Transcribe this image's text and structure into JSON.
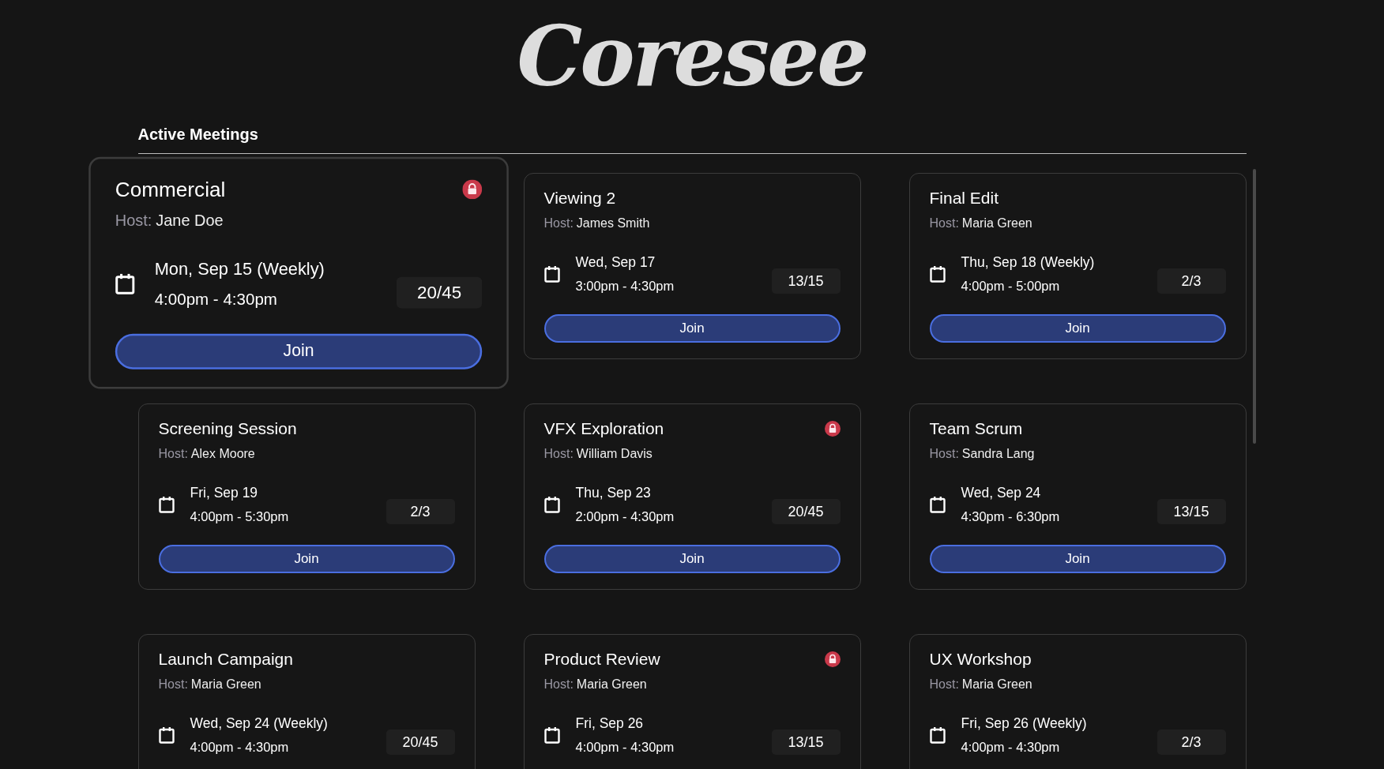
{
  "logo": "Coresee",
  "section_title": "Active Meetings",
  "meetings": [
    {
      "title": "Commercial",
      "host_label": "Host:",
      "host": "Jane Doe",
      "date": "Mon, Sep 15 (Weekly)",
      "time": "4:00pm - 4:30pm",
      "count": "20/45",
      "join_label": "Join",
      "locked": true,
      "highlighted": true
    },
    {
      "title": "Viewing 2",
      "host_label": "Host:",
      "host": "James Smith",
      "date": "Wed, Sep 17",
      "time": "3:00pm - 4:30pm",
      "count": "13/15",
      "join_label": "Join",
      "locked": false,
      "highlighted": false
    },
    {
      "title": "Final Edit",
      "host_label": "Host:",
      "host": "Maria Green",
      "date": "Thu, Sep 18 (Weekly)",
      "time": "4:00pm - 5:00pm",
      "count": "2/3",
      "join_label": "Join",
      "locked": false,
      "highlighted": false
    },
    {
      "title": "Screening Session",
      "host_label": "Host:",
      "host": "Alex Moore",
      "date": "Fri, Sep 19",
      "time": "4:00pm - 5:30pm",
      "count": "2/3",
      "join_label": "Join",
      "locked": false,
      "highlighted": false
    },
    {
      "title": "VFX Exploration",
      "host_label": "Host:",
      "host": "William Davis",
      "date": "Thu, Sep 23",
      "time": "2:00pm - 4:30pm",
      "count": "20/45",
      "join_label": "Join",
      "locked": true,
      "highlighted": false
    },
    {
      "title": "Team Scrum",
      "host_label": "Host:",
      "host": "Sandra Lang",
      "date": "Wed, Sep 24",
      "time": "4:30pm - 6:30pm",
      "count": "13/15",
      "join_label": "Join",
      "locked": false,
      "highlighted": false
    },
    {
      "title": "Launch Campaign",
      "host_label": "Host:",
      "host": "Maria Green",
      "date": "Wed, Sep 24 (Weekly)",
      "time": "4:00pm - 4:30pm",
      "count": "20/45",
      "locked": false,
      "highlighted": false
    },
    {
      "title": "Product Review",
      "host_label": "Host:",
      "host": "Maria Green",
      "date": "Fri, Sep 26",
      "time": "4:00pm - 4:30pm",
      "count": "13/15",
      "locked": true,
      "highlighted": false
    },
    {
      "title": "UX Workshop",
      "host_label": "Host:",
      "host": "Maria Green",
      "date": "Fri, Sep 26 (Weekly)",
      "time": "4:00pm - 4:30pm",
      "count": "2/3",
      "locked": false,
      "highlighted": false
    }
  ]
}
